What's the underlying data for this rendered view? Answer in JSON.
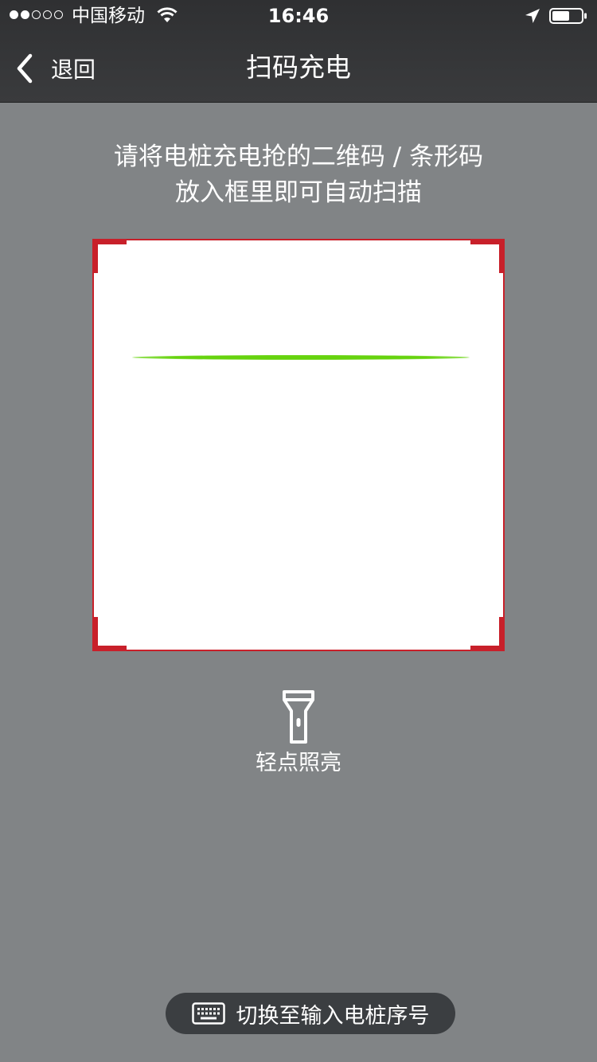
{
  "status_bar": {
    "carrier": "中国移动",
    "time": "16:46",
    "signal_strength": 2,
    "signal_max": 5,
    "battery_level": 0.6
  },
  "nav": {
    "back_label": "退回",
    "title": "扫码充电"
  },
  "instructions": {
    "line1": "请将电桩充电抢的二维码 / 条形码",
    "line2": "放入框里即可自动扫描"
  },
  "scanner": {
    "frame_color": "#c8202a",
    "scan_line_color": "#66d30e"
  },
  "flashlight": {
    "label": "轻点照亮",
    "icon": "flashlight-icon"
  },
  "manual_entry": {
    "label": "切换至输入电桩序号",
    "icon": "keyboard-icon"
  },
  "colors": {
    "background": "#818486",
    "header": "#2f3032",
    "button": "#3b3e41"
  }
}
